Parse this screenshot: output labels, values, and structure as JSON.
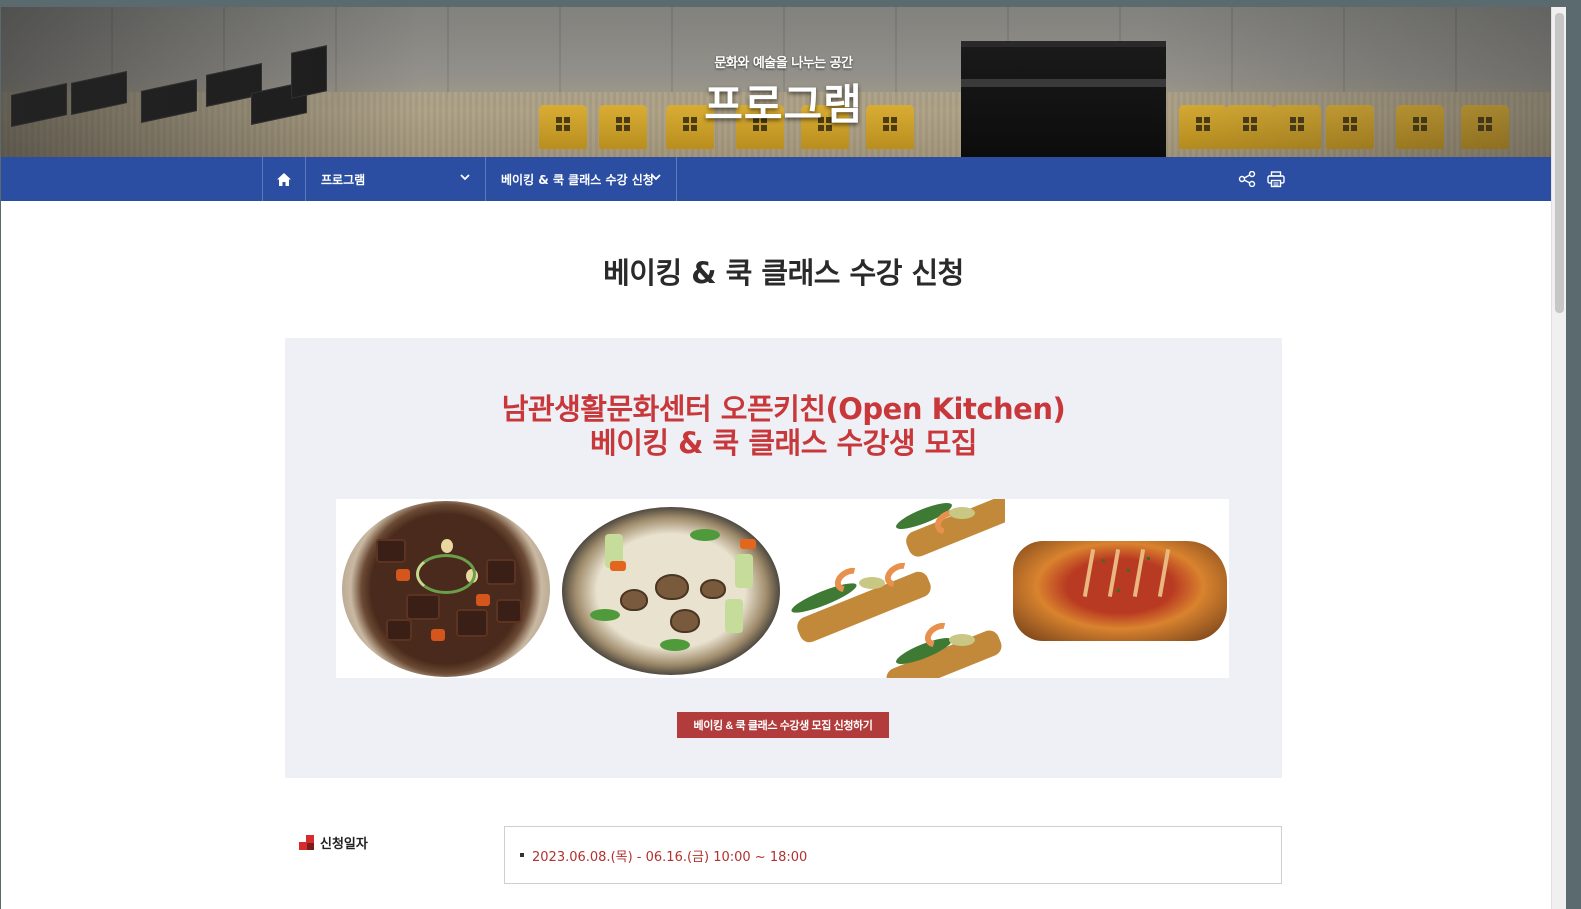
{
  "hero": {
    "subtitle": "문화와 예술을 나누는 공간",
    "title": "프로그램"
  },
  "nav": {
    "home_icon": "home-icon",
    "menu1": "프로그램",
    "menu2": "베이킹 & 쿡 클래스 수강 신청",
    "share_icon": "share-icon",
    "print_icon": "print-icon"
  },
  "page": {
    "title": "베이킹 & 쿡 클래스 수강 신청"
  },
  "banner": {
    "headline1": "남관생활문화센터 오픈키친(Open Kitchen)",
    "headline2": "베이킹 & 쿡 클래스 수강생 모집",
    "apply_button": "베이킹 & 쿡 클래스 수강생 모집 신청하기"
  },
  "info": {
    "label": "신청일자",
    "value": "2023.06.08.(목) - 06.16.(금) 10:00 ~ 18:00"
  },
  "colors": {
    "nav_bg": "#2b4ea3",
    "accent_red": "#c8373a",
    "button_red": "#b23b3b",
    "banner_bg": "#eef0f5"
  }
}
